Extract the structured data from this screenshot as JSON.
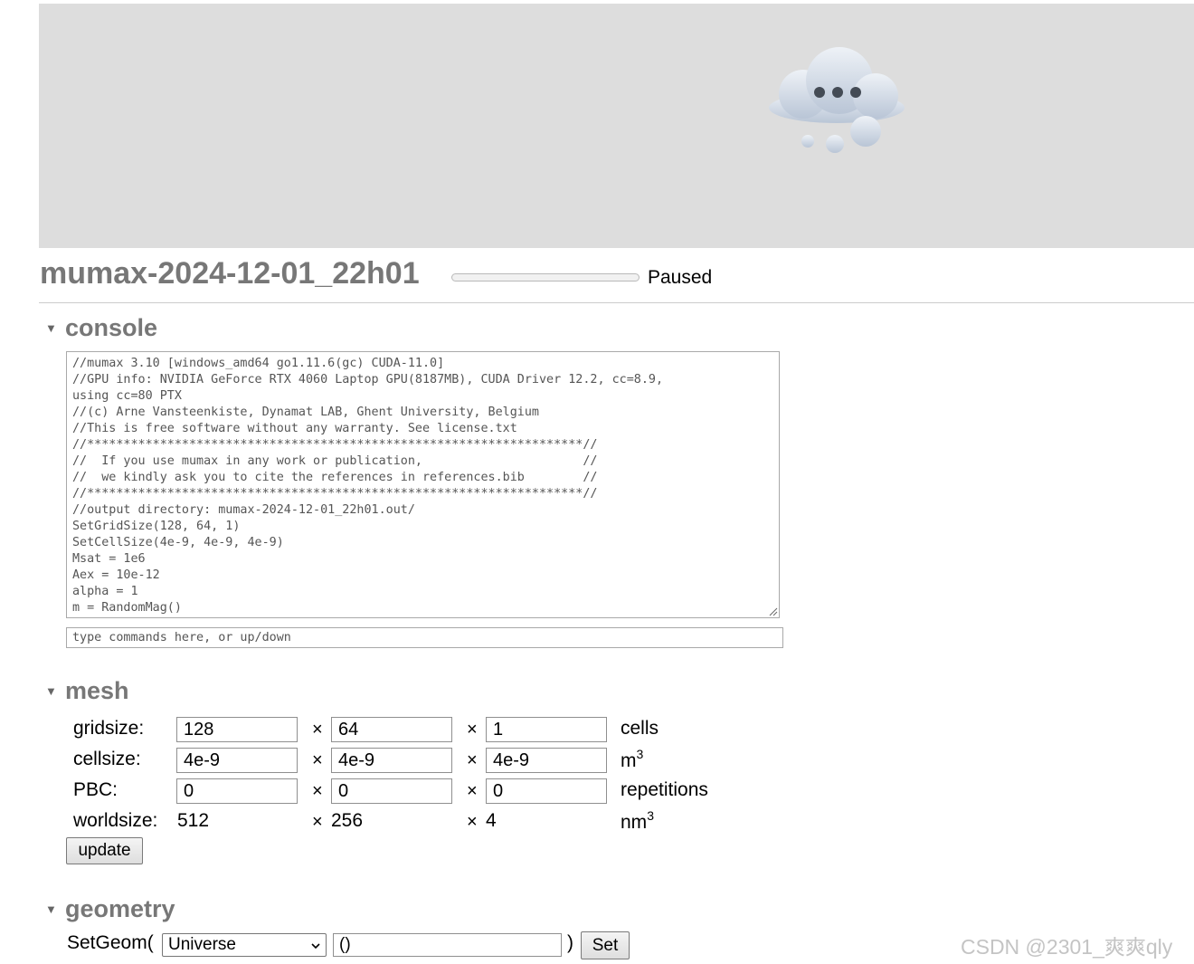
{
  "banner": {
    "icon": "loading-cloud-icon"
  },
  "header": {
    "title": "mumax-2024-12-01_22h01",
    "progress": 0,
    "status": "Paused"
  },
  "console": {
    "heading": "console",
    "lines": [
      "//mumax 3.10 [windows_amd64 go1.11.6(gc) CUDA-11.0]",
      "//GPU info: NVIDIA GeForce RTX 4060 Laptop GPU(8187MB), CUDA Driver 12.2, cc=8.9,",
      "using cc=80 PTX",
      "//(c) Arne Vansteenkiste, Dynamat LAB, Ghent University, Belgium",
      "//This is free software without any warranty. See license.txt",
      "//********************************************************************//",
      "//  If you use mumax in any work or publication,                      //",
      "//  we kindly ask you to cite the references in references.bib        //",
      "//********************************************************************//",
      "//output directory: mumax-2024-12-01_22h01.out/",
      "SetGridSize(128, 64, 1)",
      "SetCellSize(4e-9, 4e-9, 4e-9)",
      "Msat = 1e6",
      "Aex = 10e-12",
      "alpha = 1",
      "m = RandomMag()"
    ],
    "input_placeholder": "type commands here, or up/down"
  },
  "mesh": {
    "heading": "mesh",
    "times": "×",
    "gridsize": {
      "label": "gridsize:",
      "x": "128",
      "y": "64",
      "z": "1",
      "unit": "cells"
    },
    "cellsize": {
      "label": "cellsize:",
      "x": "4e-9",
      "y": "4e-9",
      "z": "4e-9",
      "unit": "m",
      "unit_sup": "3"
    },
    "pbc": {
      "label": "PBC:",
      "x": "0",
      "y": "0",
      "z": "0",
      "unit": "repetitions"
    },
    "worldsize": {
      "label": "worldsize:",
      "x": "512",
      "y": "256",
      "z": "4",
      "unit": "nm",
      "unit_sup": "3"
    },
    "update_label": "update"
  },
  "geometry": {
    "heading": "geometry",
    "call_label": "SetGeom(",
    "selected": "Universe",
    "args": "()",
    "close_paren": ")",
    "set_label": "Set"
  },
  "watermark": "CSDN @2301_爽爽qly"
}
